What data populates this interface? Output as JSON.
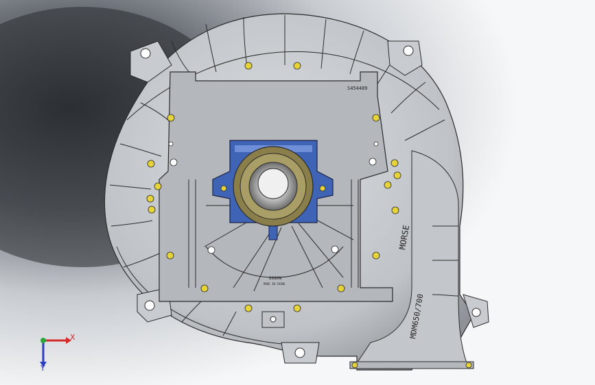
{
  "viewport": {
    "background_colors": [
      "#f6f7f8",
      "#c7cbd0",
      "#6b7077",
      "#2e3135"
    ]
  },
  "model": {
    "part_number_text": "S454489",
    "center_mark_text": "6080N",
    "center_mark_subtext": "MADE IN CHINA",
    "side_brand_text": "MORSE",
    "side_model_text": "MDM650/700"
  },
  "colors": {
    "casing": "#c8cbcf",
    "casing_dark": "#8e9298",
    "plate": "#b4b7bb",
    "bearing_housing": "#3f63b5",
    "flange_gold": "#8a7f4a",
    "bolt_yellow": "#e6d33a",
    "edge": "#2a2a2a"
  },
  "triad": {
    "x_label": "X",
    "y_label": "Y",
    "x_color": "#d62a2a",
    "y_color": "#2b3fbf",
    "origin_color": "#2fa53a"
  }
}
